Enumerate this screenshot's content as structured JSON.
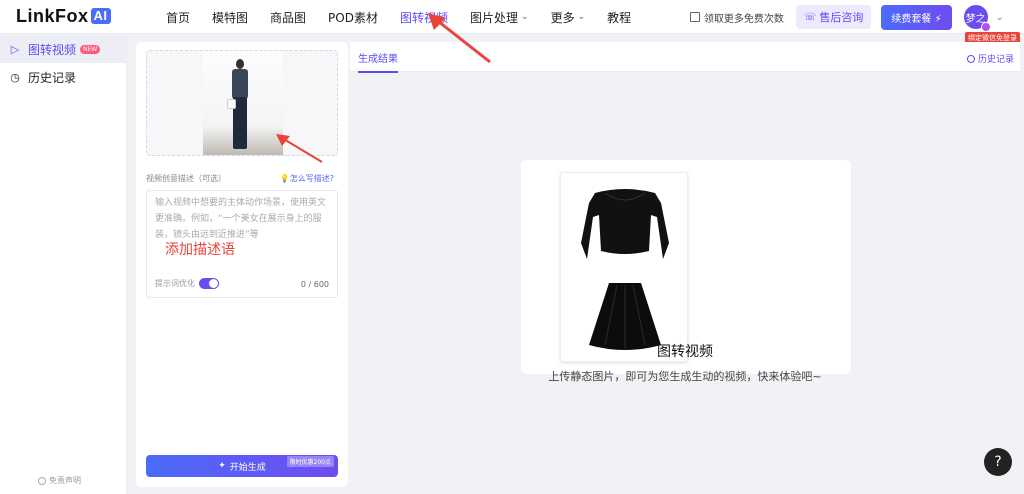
{
  "logo": {
    "text": "LinkFox",
    "badge": "AI"
  },
  "nav": {
    "items": [
      {
        "label": "首页"
      },
      {
        "label": "模特图"
      },
      {
        "label": "商品图"
      },
      {
        "label": "POD素材"
      },
      {
        "label": "图转视频"
      },
      {
        "label": "图片处理"
      },
      {
        "label": "更多"
      },
      {
        "label": "教程"
      }
    ]
  },
  "topright": {
    "free_link": "领取更多免费次数",
    "consult": "售后咨询",
    "renew": "续费套餐",
    "avatar": "梦之",
    "wx_tag": "绑定微信免登录"
  },
  "sidebar": {
    "items": [
      {
        "label": "图转视频",
        "badge": "NEW"
      },
      {
        "label": "历史记录"
      }
    ],
    "disclaimer": "免责声明"
  },
  "left_panel": {
    "desc_label": "视频创意描述（可选）",
    "how_link": "怎么写描述?",
    "placeholder": "输入视频中想要的主体动作场景，使用英文更准确。例如，“一个美女在展示身上的服装，镜头由远到近推进”等",
    "annotation": "添加描述语",
    "opt_label": "提示词优化",
    "counter": "0 / 600",
    "generate": "开始生成",
    "promo": "限时优惠200点"
  },
  "result": {
    "tab": "生成结果",
    "history": "历史记录",
    "title": "图转视频",
    "subtitle": "上传静态图片，即可为您生成生动的视频，快来体验吧~"
  },
  "help": "?",
  "colors": {
    "accent": "#5b4cf0",
    "annotation": "#e8443a"
  }
}
